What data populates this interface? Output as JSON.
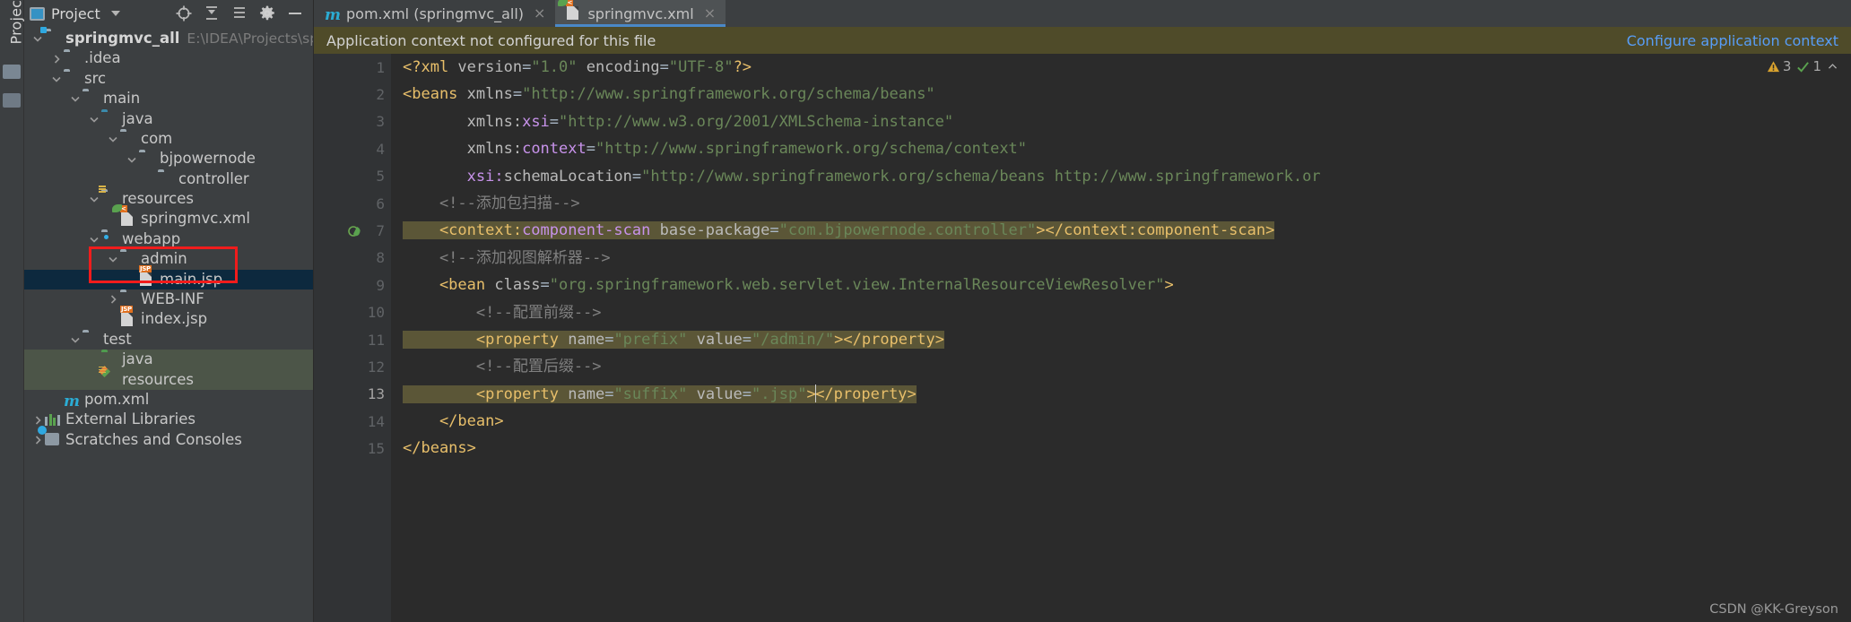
{
  "toolwindow": {
    "vertical_label": "Project"
  },
  "project_panel": {
    "title": "Project",
    "title_caret": "chevron-down",
    "header_buttons": [
      "locate-icon",
      "collapse-all-icon",
      "expand-all-icon",
      "settings-icon",
      "hide-icon"
    ],
    "tree": [
      {
        "label": "springmvc_all",
        "path": "E:\\IDEA\\Projects\\springmvc",
        "depth": 0,
        "arrow": "down",
        "icon": "module-folder",
        "bold": true
      },
      {
        "label": ".idea",
        "path": "",
        "depth": 1,
        "arrow": "right",
        "icon": "folder",
        "bold": false
      },
      {
        "label": "src",
        "path": "",
        "depth": 1,
        "arrow": "down",
        "icon": "folder",
        "bold": false
      },
      {
        "label": "main",
        "path": "",
        "depth": 2,
        "arrow": "down",
        "icon": "folder",
        "bold": false
      },
      {
        "label": "java",
        "path": "",
        "depth": 3,
        "arrow": "down",
        "icon": "source-folder",
        "bold": false
      },
      {
        "label": "com",
        "path": "",
        "depth": 4,
        "arrow": "down",
        "icon": "package",
        "bold": false
      },
      {
        "label": "bjpowernode",
        "path": "",
        "depth": 5,
        "arrow": "down",
        "icon": "package",
        "bold": false
      },
      {
        "label": "controller",
        "path": "",
        "depth": 6,
        "arrow": "none",
        "icon": "package",
        "bold": false
      },
      {
        "label": "resources",
        "path": "",
        "depth": 3,
        "arrow": "down",
        "icon": "resource-folder",
        "bold": false
      },
      {
        "label": "springmvc.xml",
        "path": "",
        "depth": 4,
        "arrow": "none",
        "icon": "spring-xml-file",
        "bold": false
      },
      {
        "label": "webapp",
        "path": "",
        "depth": 3,
        "arrow": "down",
        "icon": "webapp-folder",
        "bold": false
      },
      {
        "label": "admin",
        "path": "",
        "depth": 4,
        "arrow": "down",
        "icon": "folder",
        "bold": false
      },
      {
        "label": "main.jsp",
        "path": "",
        "depth": 5,
        "arrow": "none",
        "icon": "jsp-file",
        "bold": false,
        "selected": true
      },
      {
        "label": "WEB-INF",
        "path": "",
        "depth": 4,
        "arrow": "right",
        "icon": "folder",
        "bold": false
      },
      {
        "label": "index.jsp",
        "path": "",
        "depth": 4,
        "arrow": "none",
        "icon": "jsp-file",
        "bold": false
      },
      {
        "label": "test",
        "path": "",
        "depth": 2,
        "arrow": "down",
        "icon": "folder",
        "bold": false
      },
      {
        "label": "java",
        "path": "",
        "depth": 3,
        "arrow": "none",
        "icon": "test-source-folder",
        "bold": false,
        "green": true
      },
      {
        "label": "resources",
        "path": "",
        "depth": 3,
        "arrow": "none",
        "icon": "test-resource-folder",
        "bold": false,
        "green": true
      },
      {
        "label": "pom.xml",
        "path": "",
        "depth": 1,
        "arrow": "none",
        "icon": "maven-file",
        "bold": false
      },
      {
        "label": "External Libraries",
        "path": "",
        "depth": 0,
        "arrow": "right",
        "icon": "libraries",
        "bold": false
      },
      {
        "label": "Scratches and Consoles",
        "path": "",
        "depth": 0,
        "arrow": "right",
        "icon": "scratches",
        "bold": false
      }
    ]
  },
  "tabs": [
    {
      "label": "pom.xml (springmvc_all)",
      "icon": "maven-file",
      "active": false,
      "close": "×"
    },
    {
      "label": "springmvc.xml",
      "icon": "spring-xml-file",
      "active": true,
      "close": "×"
    }
  ],
  "notification": {
    "message": "Application context not configured for this file",
    "link": "Configure application context"
  },
  "inspection": {
    "warning_count": "3",
    "weak_count": "1",
    "warning_icon": "warning-triangle-icon",
    "weak_icon": "weak-warning-icon",
    "chevron": "⌃"
  },
  "editor": {
    "line_numbers": [
      "1",
      "2",
      "3",
      "4",
      "5",
      "6",
      "7",
      "8",
      "9",
      "10",
      "11",
      "12",
      "13",
      "14",
      "15"
    ],
    "current_line": 13,
    "lines": [
      {
        "n": 1,
        "segs": [
          {
            "t": "<?xml ",
            "c": "t-tag"
          },
          {
            "t": "version",
            "c": "t-attr"
          },
          {
            "t": "=",
            "c": "t-plain"
          },
          {
            "t": "\"1.0\"",
            "c": "t-val"
          },
          {
            "t": " ",
            "c": "t-plain"
          },
          {
            "t": "encoding",
            "c": "t-attr"
          },
          {
            "t": "=",
            "c": "t-plain"
          },
          {
            "t": "\"UTF-8\"",
            "c": "t-val"
          },
          {
            "t": "?>",
            "c": "t-tag"
          }
        ]
      },
      {
        "n": 2,
        "segs": [
          {
            "t": "<beans ",
            "c": "t-tag"
          },
          {
            "t": "xmlns",
            "c": "t-attr"
          },
          {
            "t": "=",
            "c": "t-plain"
          },
          {
            "t": "\"http://www.springframework.org/schema/beans\"",
            "c": "t-val"
          }
        ]
      },
      {
        "n": 3,
        "segs": [
          {
            "t": "       ",
            "c": "t-plain"
          },
          {
            "t": "xmlns:",
            "c": "t-attr"
          },
          {
            "t": "xsi",
            "c": "t-ns"
          },
          {
            "t": "=",
            "c": "t-plain"
          },
          {
            "t": "\"http://www.w3.org/2001/XMLSchema-instance\"",
            "c": "t-val"
          }
        ]
      },
      {
        "n": 4,
        "segs": [
          {
            "t": "       ",
            "c": "t-plain"
          },
          {
            "t": "xmlns:",
            "c": "t-attr"
          },
          {
            "t": "context",
            "c": "t-ns"
          },
          {
            "t": "=",
            "c": "t-plain"
          },
          {
            "t": "\"http://www.springframework.org/schema/context\"",
            "c": "t-val"
          }
        ]
      },
      {
        "n": 5,
        "segs": [
          {
            "t": "       ",
            "c": "t-plain"
          },
          {
            "t": "xsi:",
            "c": "t-ns"
          },
          {
            "t": "schemaLocation",
            "c": "t-attr"
          },
          {
            "t": "=",
            "c": "t-plain"
          },
          {
            "t": "\"http://www.springframework.org/schema/beans http://www.springframework.or",
            "c": "t-val"
          }
        ]
      },
      {
        "n": 6,
        "segs": [
          {
            "t": "    <!--添加包扫描-->",
            "c": "t-comment"
          }
        ]
      },
      {
        "n": 7,
        "hl": true,
        "segs": [
          {
            "t": "    <context:",
            "c": "t-tag"
          },
          {
            "t": "component-scan ",
            "c": "t-ns"
          },
          {
            "t": "base-package",
            "c": "t-attr"
          },
          {
            "t": "=",
            "c": "t-plain"
          },
          {
            "t": "\"com.bjpowernode.controller\"",
            "c": "t-val"
          },
          {
            "t": "></context:component-scan>",
            "c": "t-tag"
          }
        ]
      },
      {
        "n": 8,
        "segs": [
          {
            "t": "    <!--添加视图解析器-->",
            "c": "t-comment"
          }
        ]
      },
      {
        "n": 9,
        "segs": [
          {
            "t": "    <bean ",
            "c": "t-tag"
          },
          {
            "t": "class",
            "c": "t-attr"
          },
          {
            "t": "=",
            "c": "t-plain"
          },
          {
            "t": "\"org.springframework.web.servlet.view.InternalResourceViewResolver\"",
            "c": "t-val"
          },
          {
            "t": ">",
            "c": "t-tag"
          }
        ]
      },
      {
        "n": 10,
        "segs": [
          {
            "t": "        <!--配置前缀-->",
            "c": "t-comment"
          }
        ]
      },
      {
        "n": 11,
        "hl": true,
        "segs": [
          {
            "t": "        <property ",
            "c": "t-tag"
          },
          {
            "t": "name",
            "c": "t-attr"
          },
          {
            "t": "=",
            "c": "t-plain"
          },
          {
            "t": "\"prefix\"",
            "c": "t-val"
          },
          {
            "t": " ",
            "c": "t-plain"
          },
          {
            "t": "value",
            "c": "t-attr"
          },
          {
            "t": "=",
            "c": "t-plain"
          },
          {
            "t": "\"/admin/\"",
            "c": "t-val"
          },
          {
            "t": "></property>",
            "c": "t-tag"
          }
        ]
      },
      {
        "n": 12,
        "segs": [
          {
            "t": "        <!--配置后缀-->",
            "c": "t-comment"
          }
        ]
      },
      {
        "n": 13,
        "hl": true,
        "caret_after": "        <property name=\"suffix\" value=\".jsp\">",
        "segs": [
          {
            "t": "        <property ",
            "c": "t-tag"
          },
          {
            "t": "name",
            "c": "t-attr"
          },
          {
            "t": "=",
            "c": "t-plain"
          },
          {
            "t": "\"suffix\"",
            "c": "t-val"
          },
          {
            "t": " ",
            "c": "t-plain"
          },
          {
            "t": "value",
            "c": "t-attr"
          },
          {
            "t": "=",
            "c": "t-plain"
          },
          {
            "t": "\".jsp\"",
            "c": "t-val"
          },
          {
            "t": ">",
            "c": "t-tag"
          },
          {
            "t": "CARET",
            "c": "caret"
          },
          {
            "t": "</property>",
            "c": "t-tag"
          }
        ]
      },
      {
        "n": 14,
        "segs": [
          {
            "t": "    </bean>",
            "c": "t-tag"
          }
        ]
      },
      {
        "n": 15,
        "segs": [
          {
            "t": "</beans>",
            "c": "t-tag"
          }
        ]
      }
    ]
  },
  "watermark": "CSDN @KK-Greyson",
  "colors": {
    "panel_bg": "#3c3f41",
    "editor_bg": "#2b2b2b",
    "gutter_bg": "#313335",
    "selection_blue": "#0d293e",
    "notification_bg": "#4f4b29",
    "link_blue": "#589df6",
    "tab_active": "#4e5254",
    "tab_underline": "#4a88c7",
    "highlight_line": "#5b5637",
    "red_box": "#f01c1c",
    "test_folder_bg": "#4c5548"
  }
}
